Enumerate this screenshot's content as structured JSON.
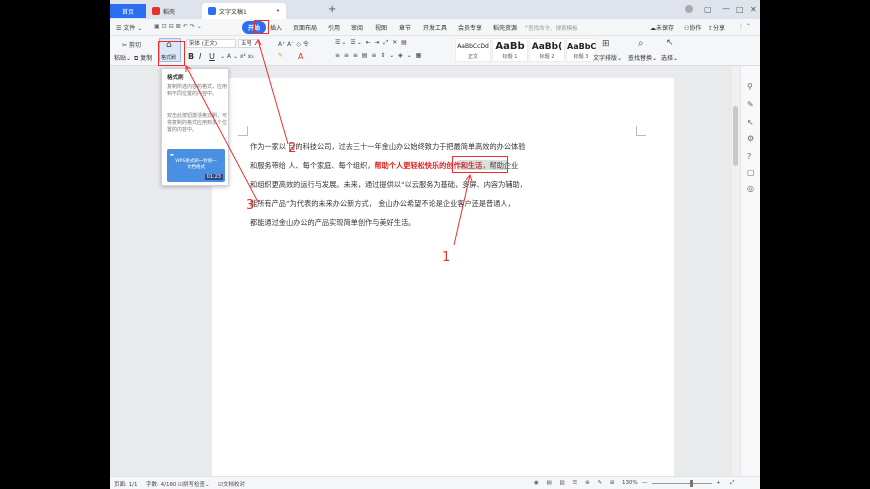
{
  "titlebar": {
    "home_tab": "首页",
    "wps_tab": "稻壳",
    "doc_tab": "文字文稿1",
    "plus": "+",
    "colors": {
      "home": "#2b6ef0",
      "wps_icon": "#e8312d",
      "doc_icon": "#2b6ef0"
    }
  },
  "menubar": {
    "file_label": "文件",
    "items": [
      "开始",
      "插入",
      "页面布局",
      "引用",
      "审阅",
      "视图",
      "章节",
      "开发工具",
      "会员专享",
      "稻壳资源"
    ],
    "search_placeholder": "查找命令、搜索模板",
    "unsaved": "未保存",
    "collab": "协作",
    "share": "分享"
  },
  "toolbar": {
    "cut": "剪切",
    "paste": "粘贴",
    "copy": "复制",
    "format_painter": "格式刷",
    "font_name": "宋体 (正文)",
    "font_size": "五号",
    "styles": [
      {
        "preview": "AaBbCcDd",
        "name": "正文"
      },
      {
        "preview": "AaBb",
        "name": "标题 1"
      },
      {
        "preview": "AaBb(",
        "name": "标题 2"
      },
      {
        "preview": "AaBbC",
        "name": "标题 3"
      }
    ],
    "text_layout": "文字排版",
    "find_replace": "查找替换",
    "select": "选择"
  },
  "document": {
    "lines": [
      {
        "text": "作为一家以               目的科技公司，过去三十一年金山办公始终致力于把最简单高效的办公体验"
      },
      {
        "pre": "和服务带给               人、每个家庭、每个组织，",
        "highlight": "帮助个人更轻松快乐的创作和生活",
        "post": "，帮助企业"
      },
      {
        "text": "和组织更高效的运行与发展。未来，通过提供以“以云服务为基础，多屏、内容为辅助，"
      },
      {
        "text": "          能所有产品”为代表的未来办公新方式， 金山办公希望不论是企业客户还是普通人，"
      },
      {
        "text": "都能通过金山办公的产品实现简单创作与美好生活。"
      }
    ]
  },
  "tooltip": {
    "title": "格式刷",
    "desc1": "复制所选内容的格式，应用到不同位置的内容中。",
    "desc2": "双击此按钮激活格式刷，可将复制的格式应用到多个位置的内容中。",
    "video_title": "WPS格式刷一秒统一文档格式",
    "video_time": "01:23"
  },
  "annotations": {
    "label1": "1",
    "label2": "2",
    "label3": "3",
    "color": "#e8312d"
  },
  "status": {
    "page": "页面: 1/1",
    "words": "字数: 4/180",
    "spell": "拼写检查",
    "proof": "文档校对",
    "zoom": "130%"
  }
}
